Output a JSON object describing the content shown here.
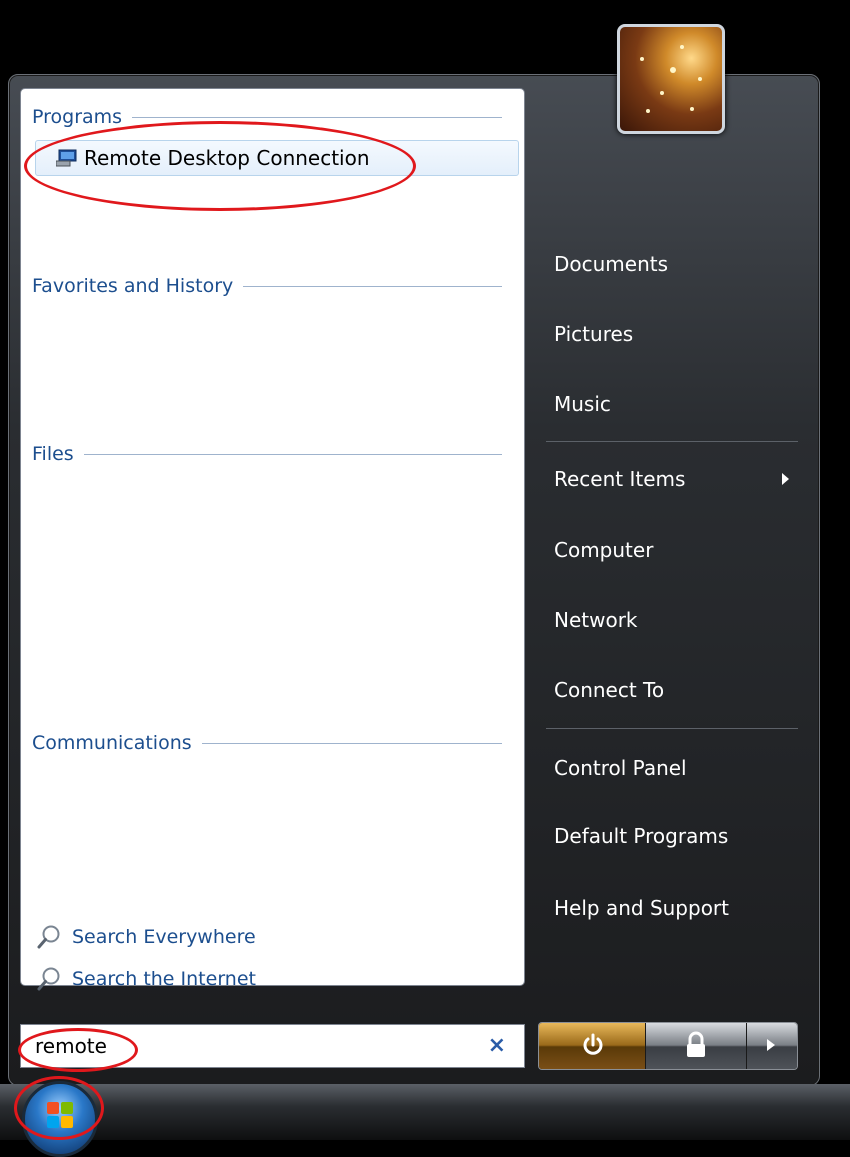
{
  "left_panel": {
    "sections": {
      "programs": "Programs",
      "favorites": "Favorites and History",
      "files": "Files",
      "communications": "Communications"
    },
    "program_result": "Remote Desktop Connection",
    "search_links": [
      "Search Everywhere",
      "Search the Internet"
    ]
  },
  "search": {
    "value": "remote",
    "clear_glyph": "×"
  },
  "right_panel": {
    "items": [
      "Documents",
      "Pictures",
      "Music",
      "Recent Items",
      "Computer",
      "Network",
      "Connect To",
      "Control Panel",
      "Default Programs",
      "Help and Support"
    ]
  },
  "colors": {
    "header_blue": "#1c4e8e",
    "annotation_red": "#e0181c"
  },
  "icons": {
    "program": "remote-desktop-icon",
    "search": "magnifier-icon",
    "power": "power-icon",
    "lock": "lock-icon",
    "more": "arrow-right-icon",
    "start": "windows-flag-icon"
  }
}
